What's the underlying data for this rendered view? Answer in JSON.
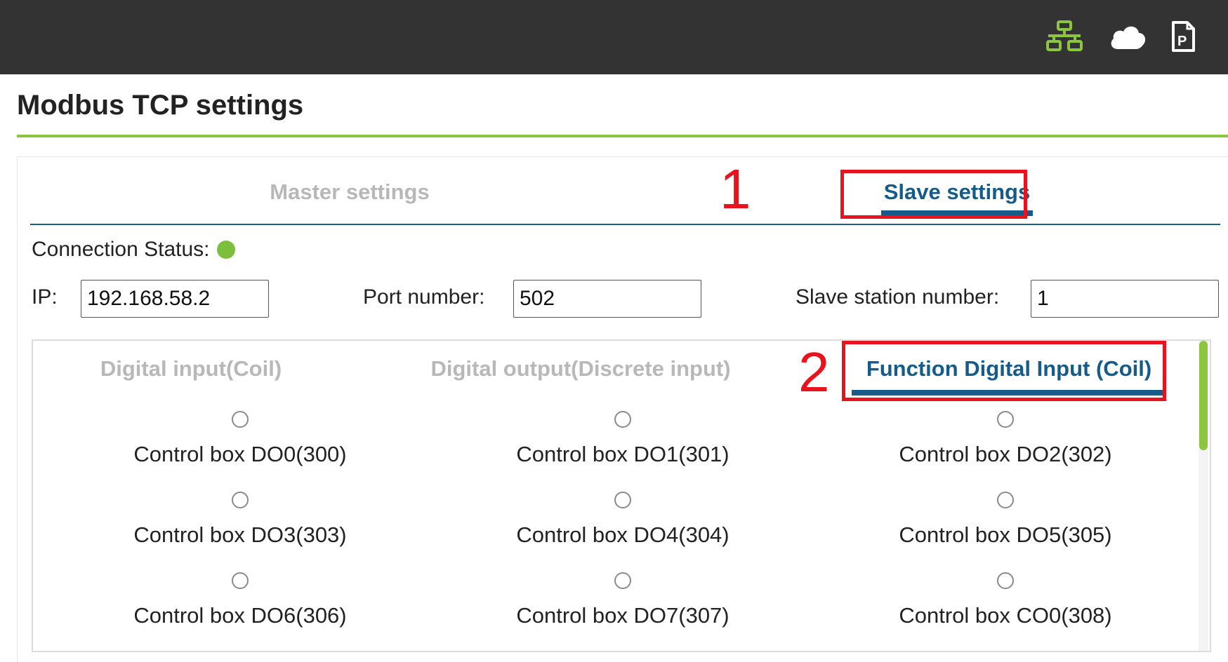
{
  "header": {
    "icons": [
      {
        "name": "network-icon",
        "color": "#8cc63f"
      },
      {
        "name": "cloud-icon",
        "color": "#ffffff"
      },
      {
        "name": "document-p-icon",
        "color": "#ffffff"
      }
    ]
  },
  "page": {
    "title": "Modbus TCP settings",
    "accent_color": "#8cc63f"
  },
  "tabs": {
    "master_label": "Master settings",
    "slave_label": "Slave settings",
    "active": "Slave settings"
  },
  "annotations": {
    "marker_1": "1",
    "marker_2": "2",
    "color": "#e8131c"
  },
  "connection": {
    "label": "Connection Status:",
    "status_color": "#7cbf3c"
  },
  "fields": {
    "ip_label": "IP:",
    "ip_value": "192.168.58.2",
    "port_label": "Port number:",
    "port_value": "502",
    "station_label": "Slave station number:",
    "station_value": "1"
  },
  "subtabs": {
    "digital_input": "Digital input(Coil)",
    "digital_output": "Digital output(Discrete input)",
    "function_digital_input": "Function Digital Input (Coil)",
    "active": "Function Digital Input (Coil)"
  },
  "options": [
    "Control box DO0(300)",
    "Control box DO1(301)",
    "Control box DO2(302)",
    "Control box DO3(303)",
    "Control box DO4(304)",
    "Control box DO5(305)",
    "Control box DO6(306)",
    "Control box DO7(307)",
    "Control box CO0(308)"
  ]
}
